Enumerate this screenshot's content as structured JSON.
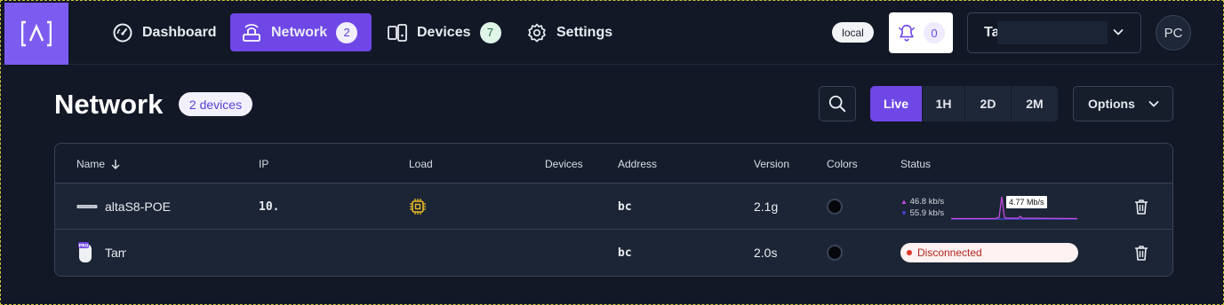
{
  "topbar": {
    "logo_icon": "caret-bracket-logo-icon",
    "nav": [
      {
        "label": "Dashboard",
        "icon": "gauge-icon"
      },
      {
        "label": "Network",
        "icon": "router-icon",
        "count": "2",
        "active": true
      },
      {
        "label": "Devices",
        "icon": "devices-icon",
        "count": "7"
      },
      {
        "label": "Settings",
        "icon": "gear-icon"
      }
    ],
    "env_chip": "local",
    "notifications_count": "0",
    "user_select_value": "Ta",
    "avatar_initials": "PC"
  },
  "header": {
    "title": "Network",
    "device_badge": "2 devices",
    "ranges": [
      "Live",
      "1H",
      "2D",
      "2M"
    ],
    "active_range": "Live",
    "options_label": "Options"
  },
  "table": {
    "columns": [
      "Name",
      "IP",
      "Load",
      "Devices",
      "Address",
      "Version",
      "Colors",
      "Status"
    ],
    "sort_column": "Name",
    "rows": [
      {
        "name": "altaS8-POE",
        "ip": "10.",
        "load_icon": "cpu-chip-icon",
        "address": "bc",
        "version": "2.1g",
        "color": "#000000",
        "status": {
          "type": "traffic",
          "upload": "46.8 kb/s",
          "download": "55.9 kb/s",
          "peak_label": "4.77 Mb/s"
        }
      },
      {
        "name": "Tam",
        "ip": "",
        "load_icon": "",
        "address": "bc",
        "version": "2.0s",
        "color": "#000000",
        "status": {
          "type": "disconnected",
          "label": "Disconnected"
        }
      }
    ]
  },
  "colors": {
    "accent": "#6f47e6",
    "background": "#121826",
    "row": "#1c2535",
    "disconnected": "#e0342a"
  }
}
